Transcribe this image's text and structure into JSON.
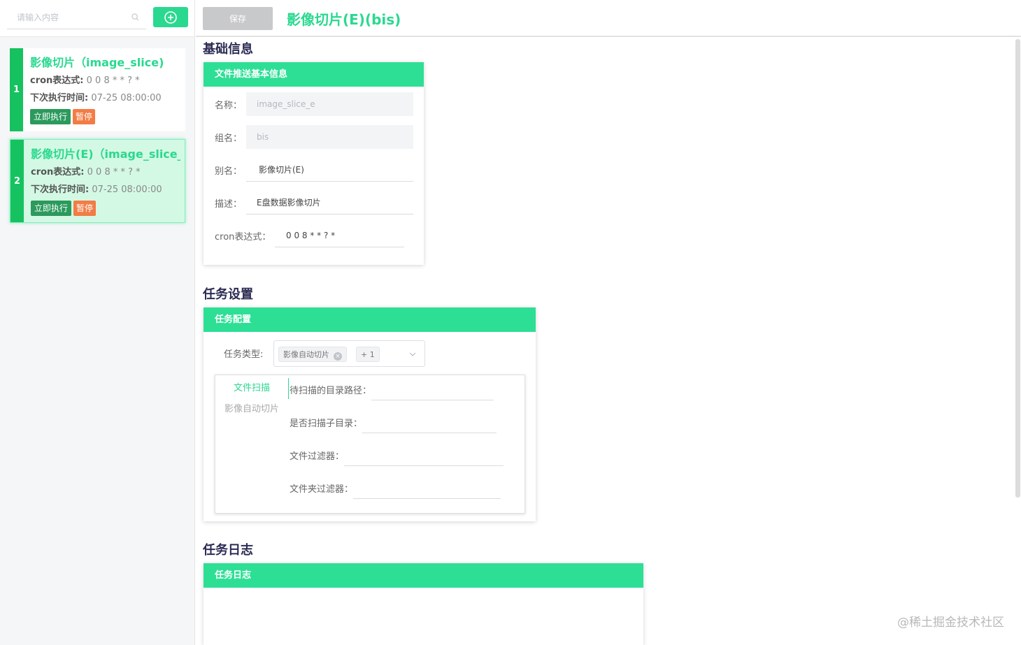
{
  "sidebar": {
    "search": {
      "placeholder": "请输入内容"
    },
    "tasks": [
      {
        "index": "1",
        "title": "影像切片（image_slice)",
        "cron_label": "cron表达式:",
        "cron_value": " 0 0 8 * * ? *",
        "next_label": "下次执行时间:",
        "next_value": " 07-25 08:00:00",
        "run_label": "立即执行",
        "pause_label": "暂停"
      },
      {
        "index": "2",
        "title": "影像切片(E)（image_slice_e)",
        "cron_label": "cron表达式:",
        "cron_value": " 0 0 8 * * ? *",
        "next_label": "下次执行时间:",
        "next_value": " 07-25 08:00:00",
        "run_label": "立即执行",
        "pause_label": "暂停"
      }
    ]
  },
  "header": {
    "save_label": "保存",
    "title": "影像切片(E)(bis)"
  },
  "basic": {
    "section_title": "基础信息",
    "panel_title": "文件推送基本信息",
    "fields": {
      "name": {
        "label": "名称：",
        "value": "image_slice_e"
      },
      "group": {
        "label": "组名：",
        "value": "bis"
      },
      "alias": {
        "label": "别名：",
        "value": "影像切片(E)"
      },
      "desc": {
        "label": "描述：",
        "value": "E盘数据影像切片"
      },
      "cron": {
        "label": "cron表达式：",
        "value": "0 0 8 * * ? *"
      }
    }
  },
  "task": {
    "section_title": "任务设置",
    "panel_title": "任务配置",
    "type_label": "任务类型:",
    "type_tag": "影像自动切片",
    "type_more": "+ 1",
    "tabs": [
      "文件扫描",
      "影像自动切片"
    ],
    "fields": [
      {
        "label": "待扫描的目录路径："
      },
      {
        "label": "是否扫描子目录："
      },
      {
        "label": "文件过滤器："
      },
      {
        "label": "文件夹过滤器："
      }
    ]
  },
  "log": {
    "section_title": "任务日志",
    "panel_title": "任务日志"
  },
  "watermark": "@稀土掘金技术社区"
}
